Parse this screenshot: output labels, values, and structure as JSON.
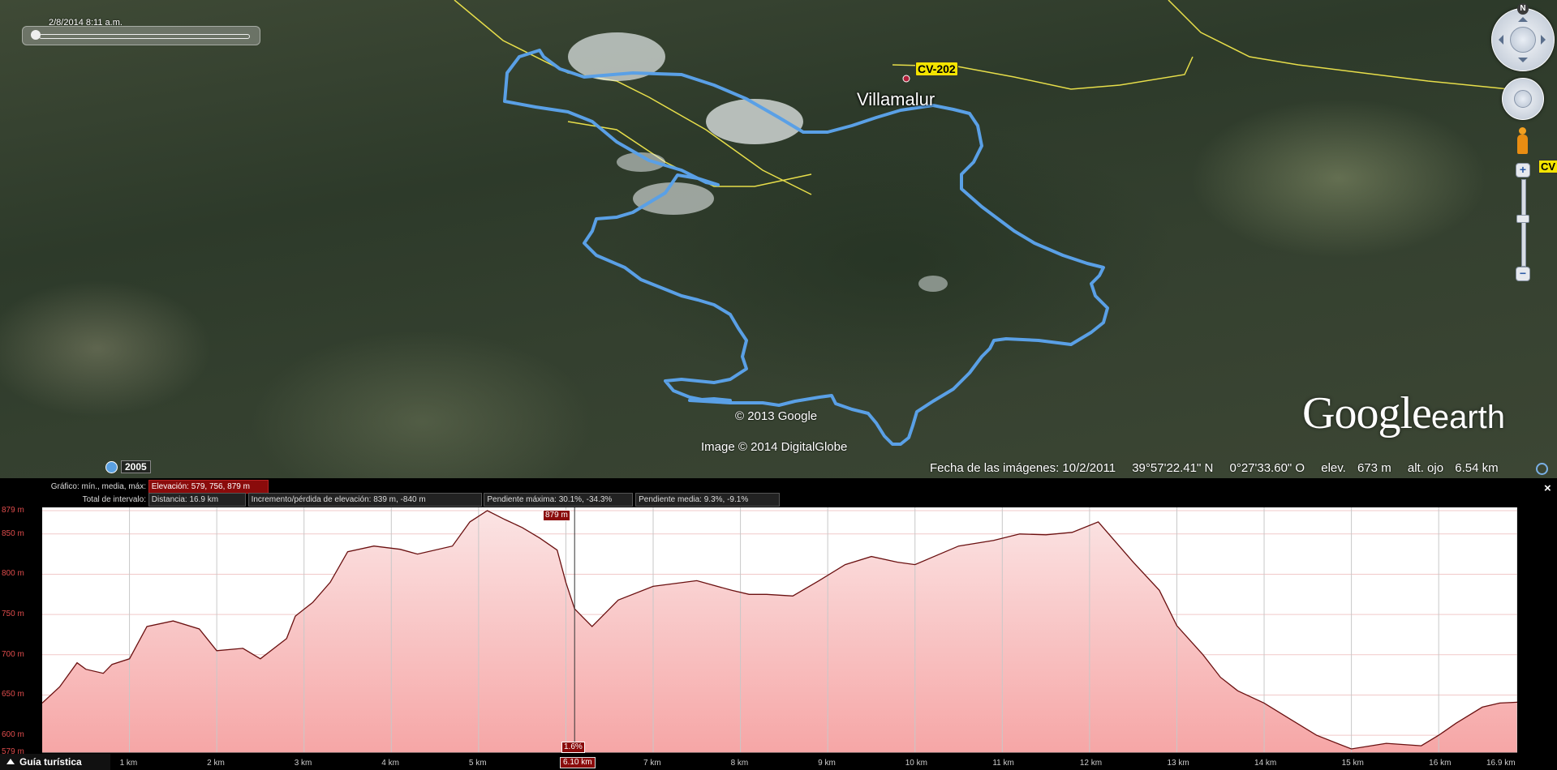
{
  "map": {
    "time_label": "2/8/2014   8:11 a.m.",
    "place_name": "Villamalur",
    "road_tag": "CV-202",
    "road_tag_right": "CV",
    "copyright_1": "© 2013 Google",
    "copyright_2": "Image © 2014 DigitalGlobe",
    "logo_main": "Google",
    "logo_sub": "earth",
    "historical_year": "2005",
    "nav_north": "N"
  },
  "status": {
    "imagery_date": "Fecha de las imágenes: 10/2/2011",
    "lat": "39°57'22.41\" N",
    "lon": "0°27'33.60\" O",
    "elev_label": "elev.",
    "elev_value": "673 m",
    "eye_label": "alt. ojo",
    "eye_value": "6.54 km"
  },
  "profile": {
    "row1_label": "Gráfico: mín., media, máx:",
    "row1_value": "Elevación: 579, 756, 879 m",
    "row2_label": "Total de intervalo:",
    "distance": "Distancia: 16.9 km",
    "gain_loss": "Incremento/pérdida de elevación: 839 m, -840 m",
    "max_slope": "Pendiente máxima: 30.1%, -34.3%",
    "avg_slope": "Pendiente media: 9.3%, -9.1%",
    "peak_tag": "879 m",
    "grade_tag": "1.6%",
    "cursor_km": "6.10 km",
    "close": "×",
    "tour_label": "Guía turística"
  },
  "chart_data": {
    "type": "area",
    "xlabel": "",
    "ylabel": "",
    "xlim": [
      0,
      16.9
    ],
    "ylim": [
      579,
      879
    ],
    "y_ticks": [
      "879 m",
      "850 m",
      "800 m",
      "750 m",
      "700 m",
      "650 m",
      "600 m",
      "579 m"
    ],
    "y_tick_values": [
      879,
      850,
      800,
      750,
      700,
      650,
      600,
      579
    ],
    "x_ticks": [
      "1 km",
      "2 km",
      "3 km",
      "4 km",
      "5 km",
      "6 km",
      "7 km",
      "8 km",
      "9 km",
      "10 km",
      "11 km",
      "12 km",
      "13 km",
      "14 km",
      "15 km",
      "16 km",
      "16.9 km"
    ],
    "x_tick_values": [
      1,
      2,
      3,
      4,
      5,
      6,
      7,
      8,
      9,
      10,
      11,
      12,
      13,
      14,
      15,
      16,
      16.9
    ],
    "colors": {
      "line": "#6a1010",
      "fill_top": "#fbe4e4",
      "fill_bottom": "#f6a6a6",
      "grid": "#c8c8c8",
      "tick": "#e04c4c"
    },
    "series": [
      {
        "x": [
          0,
          0.2,
          0.4,
          0.5,
          0.7,
          0.8,
          1.0,
          1.2,
          1.5,
          1.8,
          2.0,
          2.3,
          2.5,
          2.8,
          2.9,
          3.1,
          3.3,
          3.5,
          3.8,
          4.1,
          4.3,
          4.7,
          4.9,
          5.1,
          5.3,
          5.5,
          5.7,
          5.9,
          6.0,
          6.1,
          6.3,
          6.6,
          7.0,
          7.5,
          7.9,
          8.1,
          8.3,
          8.6,
          8.9,
          9.2,
          9.5,
          9.8,
          10.0,
          10.5,
          10.9,
          11.2,
          11.5,
          11.8,
          12.1,
          12.5,
          12.8,
          13.0,
          13.3,
          13.5,
          13.7,
          14.0,
          14.3,
          14.6,
          15.0,
          15.4,
          15.8,
          16.0,
          16.2,
          16.5,
          16.7,
          16.9
        ],
        "values": [
          640,
          660,
          690,
          682,
          677,
          688,
          695,
          735,
          742,
          732,
          705,
          708,
          695,
          720,
          748,
          765,
          790,
          828,
          835,
          831,
          825,
          835,
          865,
          879,
          868,
          858,
          845,
          830,
          790,
          757,
          735,
          768,
          785,
          792,
          780,
          775,
          775,
          773,
          792,
          812,
          822,
          815,
          812,
          835,
          842,
          850,
          849,
          852,
          865,
          815,
          780,
          736,
          700,
          672,
          655,
          640,
          620,
          600,
          583,
          590,
          587,
          600,
          615,
          635,
          640,
          641
        ]
      }
    ]
  }
}
